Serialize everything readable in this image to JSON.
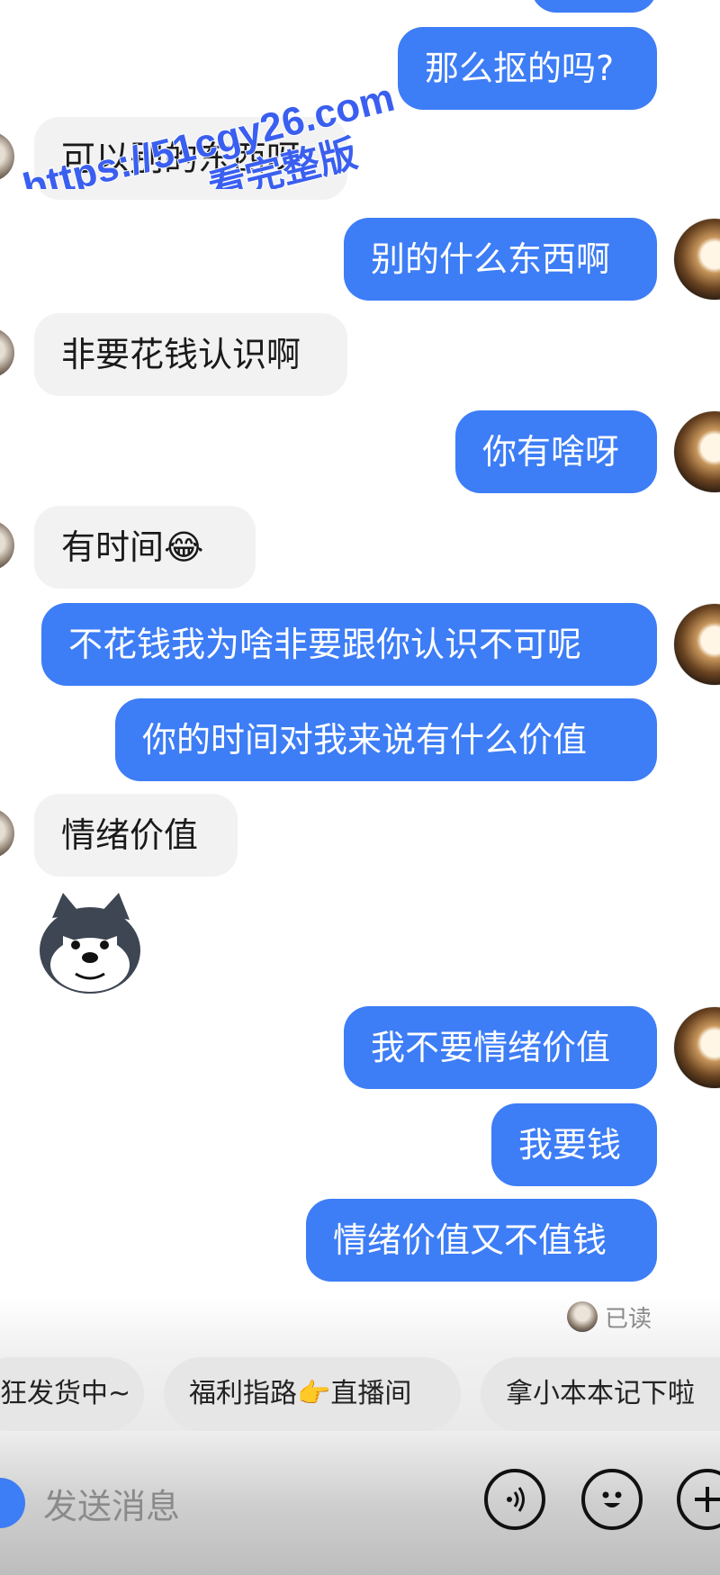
{
  "messages": [
    {
      "side": "out",
      "text": "那么抠的吗?",
      "avatar": false
    },
    {
      "side": "in",
      "text": "可以别的东西呀",
      "avatar": true
    },
    {
      "side": "out",
      "text": "别的什么东西啊",
      "avatar": true
    },
    {
      "side": "in",
      "text": "非要花钱认识啊",
      "avatar": true
    },
    {
      "side": "out",
      "text": "你有啥呀",
      "avatar": true
    },
    {
      "side": "in",
      "text": "有时间😂",
      "avatar": true
    },
    {
      "side": "out",
      "text": "不花钱我为啥非要跟你认识不可呢",
      "avatar": true
    },
    {
      "side": "out",
      "text": "你的时间对我来说有什么价值",
      "avatar": false
    },
    {
      "side": "in",
      "text": "情绪价值",
      "avatar": true
    },
    {
      "side": "in",
      "sticker": "husky-sticker"
    },
    {
      "side": "out",
      "text": "我不要情绪价值",
      "avatar": true
    },
    {
      "side": "out",
      "text": "我要钱",
      "avatar": false
    },
    {
      "side": "out",
      "text": "情绪价值又不值钱",
      "avatar": false
    }
  ],
  "read_receipt": "已读",
  "quick_replies": [
    "狂发货中~",
    "福利指路👉直播间",
    "拿小本本记下啦"
  ],
  "input": {
    "placeholder": "发送消息"
  },
  "buttons": {
    "voice_icon": "voice-icon",
    "emoji_icon": "emoji-icon",
    "plus_icon": "plus-icon"
  },
  "watermark": {
    "line1": "https://51cgy26.com",
    "line2": "看完整版"
  },
  "colors": {
    "outgoing_bubble": "#3d7df6",
    "incoming_bubble": "#f2f2f2",
    "watermark": "#3a5ff0"
  }
}
